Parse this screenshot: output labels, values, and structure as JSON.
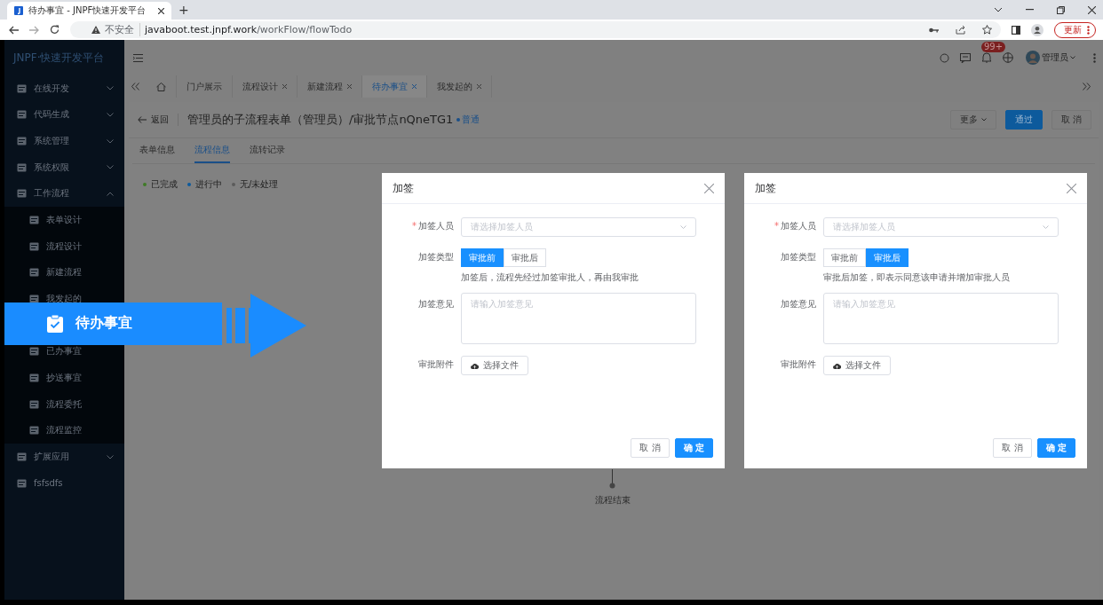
{
  "browser": {
    "tab_title": "待办事宜 - JNPF快速开发平台",
    "new_tab": "+",
    "security": "不安全",
    "url_host": "javaboot.test.jnpf.work",
    "url_path": "/workFlow/flowTodo",
    "update_button": "更新"
  },
  "app": {
    "logo": "JNPF·快速开发平台",
    "notification_badge": "99+",
    "user": "管理员"
  },
  "sidebar": {
    "items": [
      {
        "label": "在线开发",
        "expanded": false
      },
      {
        "label": "代码生成",
        "expanded": false
      },
      {
        "label": "系统管理",
        "expanded": false
      },
      {
        "label": "系统权限",
        "expanded": false
      },
      {
        "label": "工作流程",
        "expanded": true,
        "children": [
          {
            "kind": "item",
            "label": "表单设计"
          },
          {
            "kind": "item",
            "label": "流程设计"
          },
          {
            "kind": "item",
            "label": "新建流程"
          },
          {
            "kind": "item",
            "label": "我发起的"
          },
          {
            "kind": "callout",
            "label": "待办事宜"
          },
          {
            "kind": "item",
            "label": "已办事宜"
          },
          {
            "kind": "item",
            "label": "抄送事宜"
          },
          {
            "kind": "item",
            "label": "流程委托"
          },
          {
            "kind": "item",
            "label": "流程监控"
          }
        ]
      },
      {
        "label": "扩展应用",
        "expanded": false
      },
      {
        "label": "fsfsdfs"
      }
    ]
  },
  "tabs": [
    {
      "kind": "home",
      "selected": false
    },
    {
      "kind": "page",
      "label": "门户展示",
      "closable": false,
      "selected": false
    },
    {
      "kind": "page",
      "label": "流程设计",
      "closable": true,
      "selected": false
    },
    {
      "kind": "page",
      "label": "新建流程",
      "closable": true,
      "selected": false
    },
    {
      "kind": "page",
      "label": "待办事宜",
      "closable": true,
      "selected": true
    },
    {
      "kind": "page",
      "label": "我发起的",
      "closable": true,
      "selected": false
    }
  ],
  "page": {
    "back": "返回",
    "title": "管理员的子流程表单（管理员）/审批节点nQneTG1",
    "tag": "普通",
    "buttons": [
      {
        "kind": "dropdown",
        "label": "更多"
      },
      {
        "kind": "primary",
        "label": "通过"
      },
      {
        "kind": "default",
        "label": "取 消"
      }
    ],
    "tabs": [
      {
        "label": "表单信息",
        "selected": false
      },
      {
        "label": "流程信息",
        "selected": true
      },
      {
        "label": "流转记录",
        "selected": false
      }
    ],
    "legend": [
      {
        "label": "已完成",
        "color": "#3f7a26"
      },
      {
        "label": "进行中",
        "color": "#0d5a9c"
      },
      {
        "label": "无/未处理",
        "color": "#5c5c5c"
      }
    ],
    "flow_end": "流程结束"
  },
  "dialogs": [
    {
      "title": "加签",
      "fields": [
        {
          "kind": "select",
          "label": "加签人员",
          "required_mark": "*",
          "placeholder": "请选择加签人员"
        },
        {
          "kind": "radio",
          "label": "加签类型",
          "options": [
            {
              "label": "审批前",
              "selected": true
            },
            {
              "label": "审批后",
              "selected": false
            }
          ],
          "hint": "加签后，流程先经过加签审批人，再由我审批"
        },
        {
          "kind": "textarea",
          "label": "加签意见",
          "placeholder": "请输入加签意见"
        },
        {
          "kind": "upload",
          "label": "审批附件",
          "button": "选择文件"
        }
      ],
      "buttons": [
        {
          "kind": "default",
          "label": "取 消"
        },
        {
          "kind": "primary",
          "label": "确 定"
        }
      ]
    },
    {
      "title": "加签",
      "fields": [
        {
          "kind": "select",
          "label": "加签人员",
          "required_mark": "*",
          "placeholder": "请选择加签人员"
        },
        {
          "kind": "radio",
          "label": "加签类型",
          "options": [
            {
              "label": "审批前",
              "selected": false
            },
            {
              "label": "审批后",
              "selected": true
            }
          ],
          "hint": "审批后加签，即表示同意该申请并增加审批人员"
        },
        {
          "kind": "textarea",
          "label": "加签意见",
          "placeholder": "请输入加签意见"
        },
        {
          "kind": "upload",
          "label": "审批附件",
          "button": "选择文件"
        }
      ],
      "buttons": [
        {
          "kind": "default",
          "label": "取 消"
        },
        {
          "kind": "primary",
          "label": "确 定"
        }
      ]
    }
  ]
}
